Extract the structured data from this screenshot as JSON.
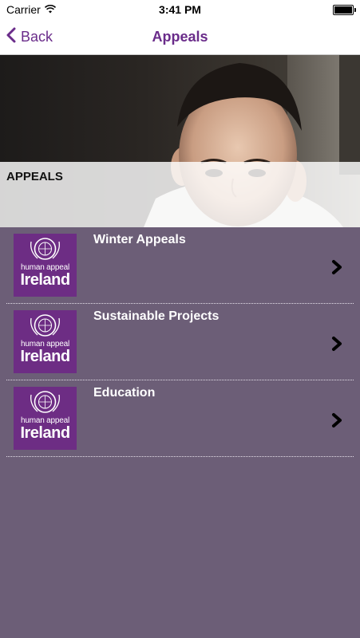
{
  "status_bar": {
    "carrier": "Carrier",
    "time": "3:41 PM"
  },
  "nav_bar": {
    "back_label": "Back",
    "title": "Appeals"
  },
  "hero": {
    "heading": "APPEALS"
  },
  "logo": {
    "line1": "human appeal",
    "line2": "Ireland"
  },
  "appeals": [
    {
      "title": "Winter Appeals"
    },
    {
      "title": "Sustainable Projects"
    },
    {
      "title": "Education"
    }
  ],
  "colors": {
    "brand_purple": "#6a2c8a",
    "list_background": "#6c5e77",
    "logo_background": "#6d2d84"
  },
  "icons": {
    "wifi": "wifi-icon",
    "battery": "battery-icon",
    "back": "chevron-left-icon",
    "disclosure": "chevron-right-icon"
  }
}
